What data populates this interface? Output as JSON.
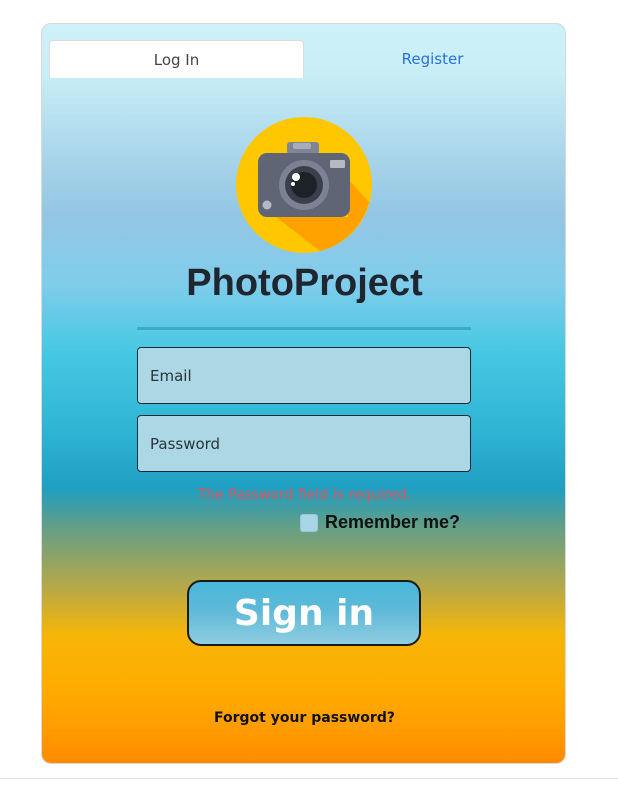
{
  "tabs": {
    "login_label": "Log In",
    "register_label": "Register"
  },
  "brand": {
    "title": "PhotoProject",
    "logo_icon": "camera-icon"
  },
  "form": {
    "email_placeholder": "Email",
    "password_placeholder": "Password",
    "password_error": "The Password field is required.",
    "remember_label": "Remember me?",
    "remember_checked": false,
    "signin_label": "Sign in",
    "forgot_label": "Forgot your password?"
  },
  "colors": {
    "tab_register_link": "#2a6fdb",
    "error_text": "#e6505a",
    "logo_circle": "#ffc700",
    "logo_shadow": "#ffa200",
    "signin_button": "#5db9d8"
  }
}
